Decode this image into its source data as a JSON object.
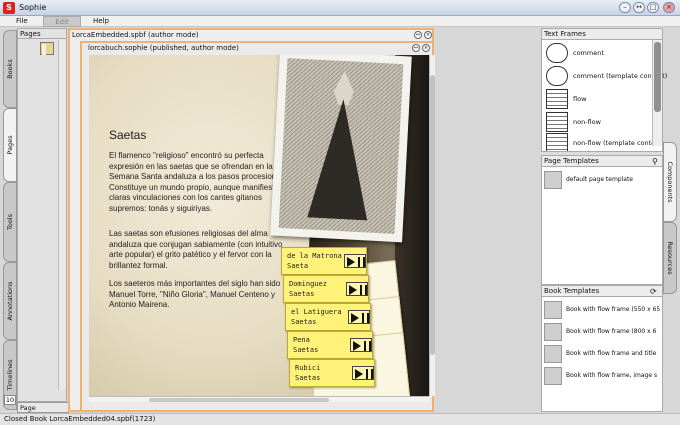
{
  "app": {
    "title": "Sophie",
    "icon_letter": "S"
  },
  "window_controls": {
    "minimize": "–",
    "maximize": "□",
    "restore": "↔",
    "close": "×"
  },
  "menu": [
    "File",
    "Edit",
    "Help"
  ],
  "left_tabs": [
    "Books",
    "Pages",
    "Tools",
    "Annotations",
    "Timelines"
  ],
  "pages_panel": {
    "title": "Pages",
    "footer_tab": "Page Structure"
  },
  "doc": {
    "outer_title": "LorcaEmbedded.spbf (author mode)",
    "inner_title": "lorcabuch.sophie (published, author mode)",
    "zoom": "10"
  },
  "book_page": {
    "heading": "Saetas",
    "paragraphs": [
      "El flamenco \"religioso\" encontró su perfecta expresión en las saetas que se ofrendan en la Semana Santa andaluza a los pasos procesionales. Constituye un mundo propio, aunque manifieste claras vinculaciones con los cantes gitanos supremos: tonás y siguiriyas.",
      "Las saetas son efusiones religiosas del alma andaluza que conjugan sabiamente (con intuitivo arte popular) el grito patético y el fervor con la brillantez formal.",
      "Los saeteros más importantes del siglo han sido Manuel Torre, \"Niño Gloria\", Manuel Centeno y Antonio Mairena."
    ],
    "notes": [
      {
        "line1": "de la Matrona",
        "line2": "Saeta"
      },
      {
        "line1": "Dominguez",
        "line2": "Saetas"
      },
      {
        "line1": "el Latiguera",
        "line2": "Saetas"
      },
      {
        "line1": "Pena",
        "line2": "Saetas"
      },
      {
        "line1": "Rubici",
        "line2": "Saetas"
      }
    ]
  },
  "text_frames": {
    "title": "Text Frames",
    "items": [
      "comment",
      "comment (template content)",
      "flow",
      "non-flow",
      "non-flow (template content)"
    ]
  },
  "page_templates": {
    "title": "Page Templates",
    "items": [
      "default page template"
    ]
  },
  "book_templates": {
    "title": "Book Templates",
    "items": [
      "Book with flow frame (550 x 65",
      "Book with flow frame (800 x 6",
      "Book with flow frame and title",
      "Book with flow frame, image s"
    ]
  },
  "right_tabs": [
    "Components",
    "Resources"
  ],
  "status": "Closed Book LorcaEmbedded04.spbf(1723)"
}
